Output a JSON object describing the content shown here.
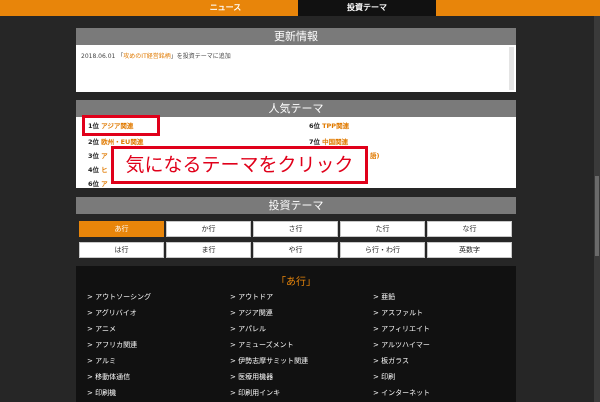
{
  "nav": {
    "tabs": [
      "ニュース",
      "投資テーマ"
    ]
  },
  "updates": {
    "title": "更新情報",
    "entry": {
      "date": "2018.06.01",
      "open_quote": "「",
      "link": "攻めのIT経営銘柄",
      "close_text": "」を投資テーマに追加"
    }
  },
  "popular": {
    "title": "人気テーマ",
    "left": [
      {
        "rank": "1位",
        "name": "アジア関連"
      },
      {
        "rank": "2位",
        "name": "欧州・EU関連"
      },
      {
        "rank": "3位",
        "name": "ア"
      },
      {
        "rank": "4位",
        "name": "ヒ"
      },
      {
        "rank": "6位",
        "name": "ア"
      }
    ],
    "right": [
      {
        "rank": "6位",
        "name": "TPP関連"
      },
      {
        "rank": "7位",
        "name": "中国関連"
      },
      {
        "rank": "",
        "name": "語)"
      }
    ]
  },
  "callout": {
    "text": "気になるテーマをクリック"
  },
  "themes": {
    "title": "投資テーマ",
    "row1": [
      "あ行",
      "か行",
      "さ行",
      "た行",
      "な行"
    ],
    "row2": [
      "は行",
      "ま行",
      "や行",
      "ら行・わ行",
      "英数字"
    ],
    "active": "あ行"
  },
  "a_list": {
    "title": "「あ行」",
    "col1": [
      "> アウトソーシング",
      "> アグリバイオ",
      "> アニメ",
      "> アフリカ関連",
      "> アルミ",
      "> 移動体通信",
      "> 印刷機"
    ],
    "col2": [
      "> アウトドア",
      "> アジア関連",
      "> アパレル",
      "> アミューズメント",
      "> 伊勢志摩サミット関連",
      "> 医療用機器",
      "> 印刷用インキ"
    ],
    "col3": [
      "> 亜鉛",
      "> アスファルト",
      "> アフィリエイト",
      "> アルツハイマー",
      "> 板ガラス",
      "> 印刷",
      "> インターネット"
    ]
  },
  "colors": {
    "accent": "#e8850a",
    "callout_red": "#e0001a",
    "header_gray": "#7a7a7a",
    "dark_bg": "#262626"
  }
}
